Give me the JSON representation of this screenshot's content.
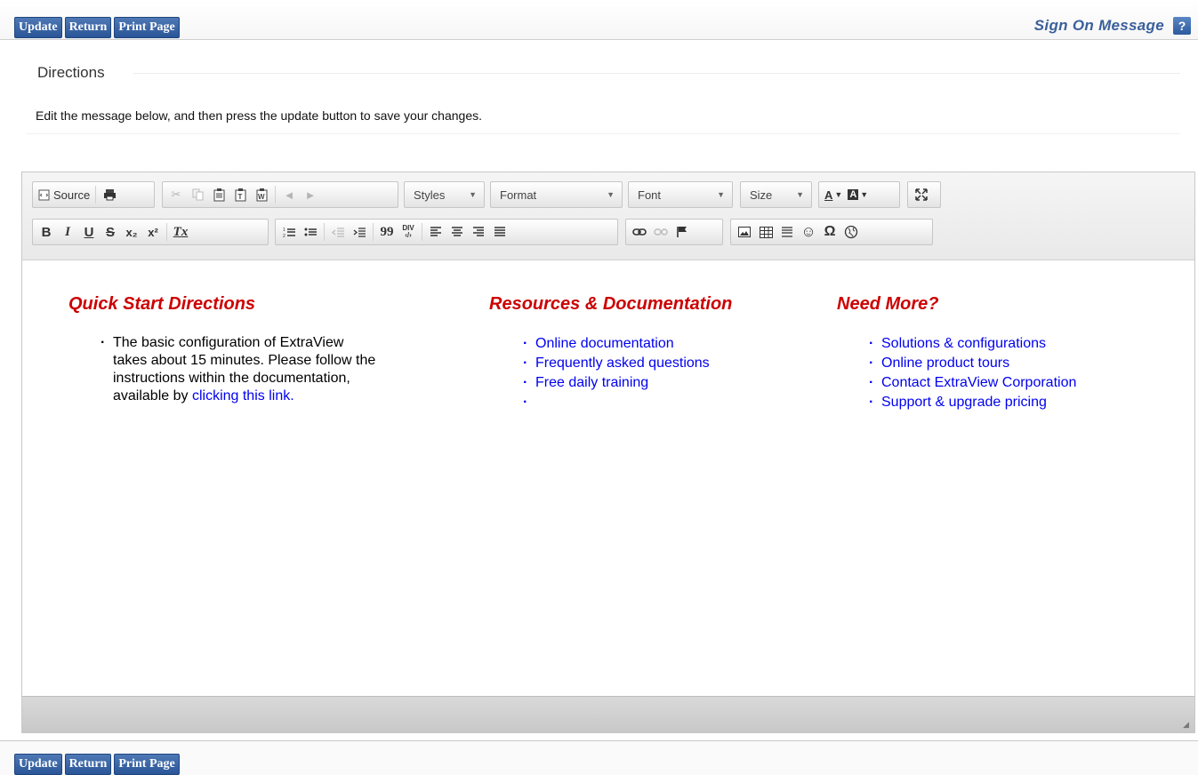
{
  "toolbar_buttons": {
    "update": "Update",
    "return": "Return",
    "print": "Print Page"
  },
  "page_title": "Sign On Message",
  "help_label": "?",
  "directions": {
    "legend": "Directions",
    "text": "Edit the message below, and then press the update button to save your changes."
  },
  "editor": {
    "source_label": "Source",
    "styles": "Styles",
    "format": "Format",
    "font": "Font",
    "size": "Size",
    "text_color": "A",
    "bg_color": "A",
    "bold": "B",
    "italic": "I",
    "underline": "U",
    "strike": "S",
    "subscript": "x₂",
    "superscript": "x²",
    "remove_format": "Tx",
    "blockquote": "99",
    "div_label": "DIV",
    "omega": "Ω"
  },
  "content": {
    "col1": {
      "heading": "Quick Start Directions",
      "line1": "The basic configuration of ExtraView",
      "line2": "takes about 15 minutes. Please follow the",
      "line3": "instructions within the documentation,",
      "line4_prefix": "available by ",
      "line4_link": "clicking this link."
    },
    "col2": {
      "heading": "Resources & Documentation",
      "items": [
        "Online documentation",
        "Frequently asked questions",
        "Free daily training",
        ""
      ]
    },
    "col3": {
      "heading": "Need More?",
      "items": [
        "Solutions & configurations",
        "Online product tours",
        "Contact ExtraView Corporation",
        "Support & upgrade pricing"
      ]
    }
  }
}
